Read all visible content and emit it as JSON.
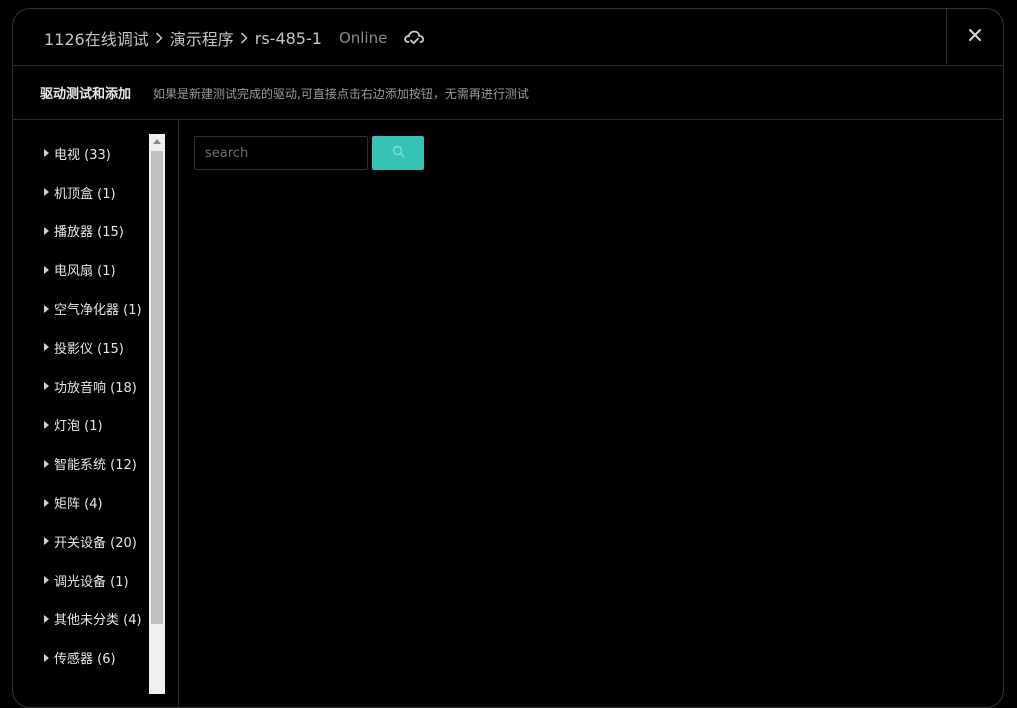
{
  "header": {
    "breadcrumb": [
      "1126在线调试",
      "演示程序",
      "rs-485-1"
    ],
    "status": "Online",
    "cloud_icon": "cloud-sync-icon",
    "close_icon": "close-icon"
  },
  "subheader": {
    "title": "驱动测试和添加",
    "hint": "如果是新建测试完成的驱动,可直接点击右边添加按钮，无需再进行测试"
  },
  "tree": {
    "items": [
      {
        "label": "电视 (33)"
      },
      {
        "label": "机顶盒 (1)"
      },
      {
        "label": "播放器 (15)"
      },
      {
        "label": "电风扇 (1)"
      },
      {
        "label": "空气净化器 (1)"
      },
      {
        "label": "投影仪 (15)"
      },
      {
        "label": "功放音响 (18)"
      },
      {
        "label": "灯泡 (1)"
      },
      {
        "label": "智能系统 (12)"
      },
      {
        "label": "矩阵 (4)"
      },
      {
        "label": "开关设备 (20)"
      },
      {
        "label": "调光设备 (1)"
      },
      {
        "label": "其他未分类 (4)"
      },
      {
        "label": "传感器 (6)"
      }
    ]
  },
  "search": {
    "placeholder": "search",
    "value": "",
    "button_icon": "search-icon"
  },
  "colors": {
    "accent": "#36c2b4",
    "background": "#000000",
    "border": "#2a2a2a"
  }
}
